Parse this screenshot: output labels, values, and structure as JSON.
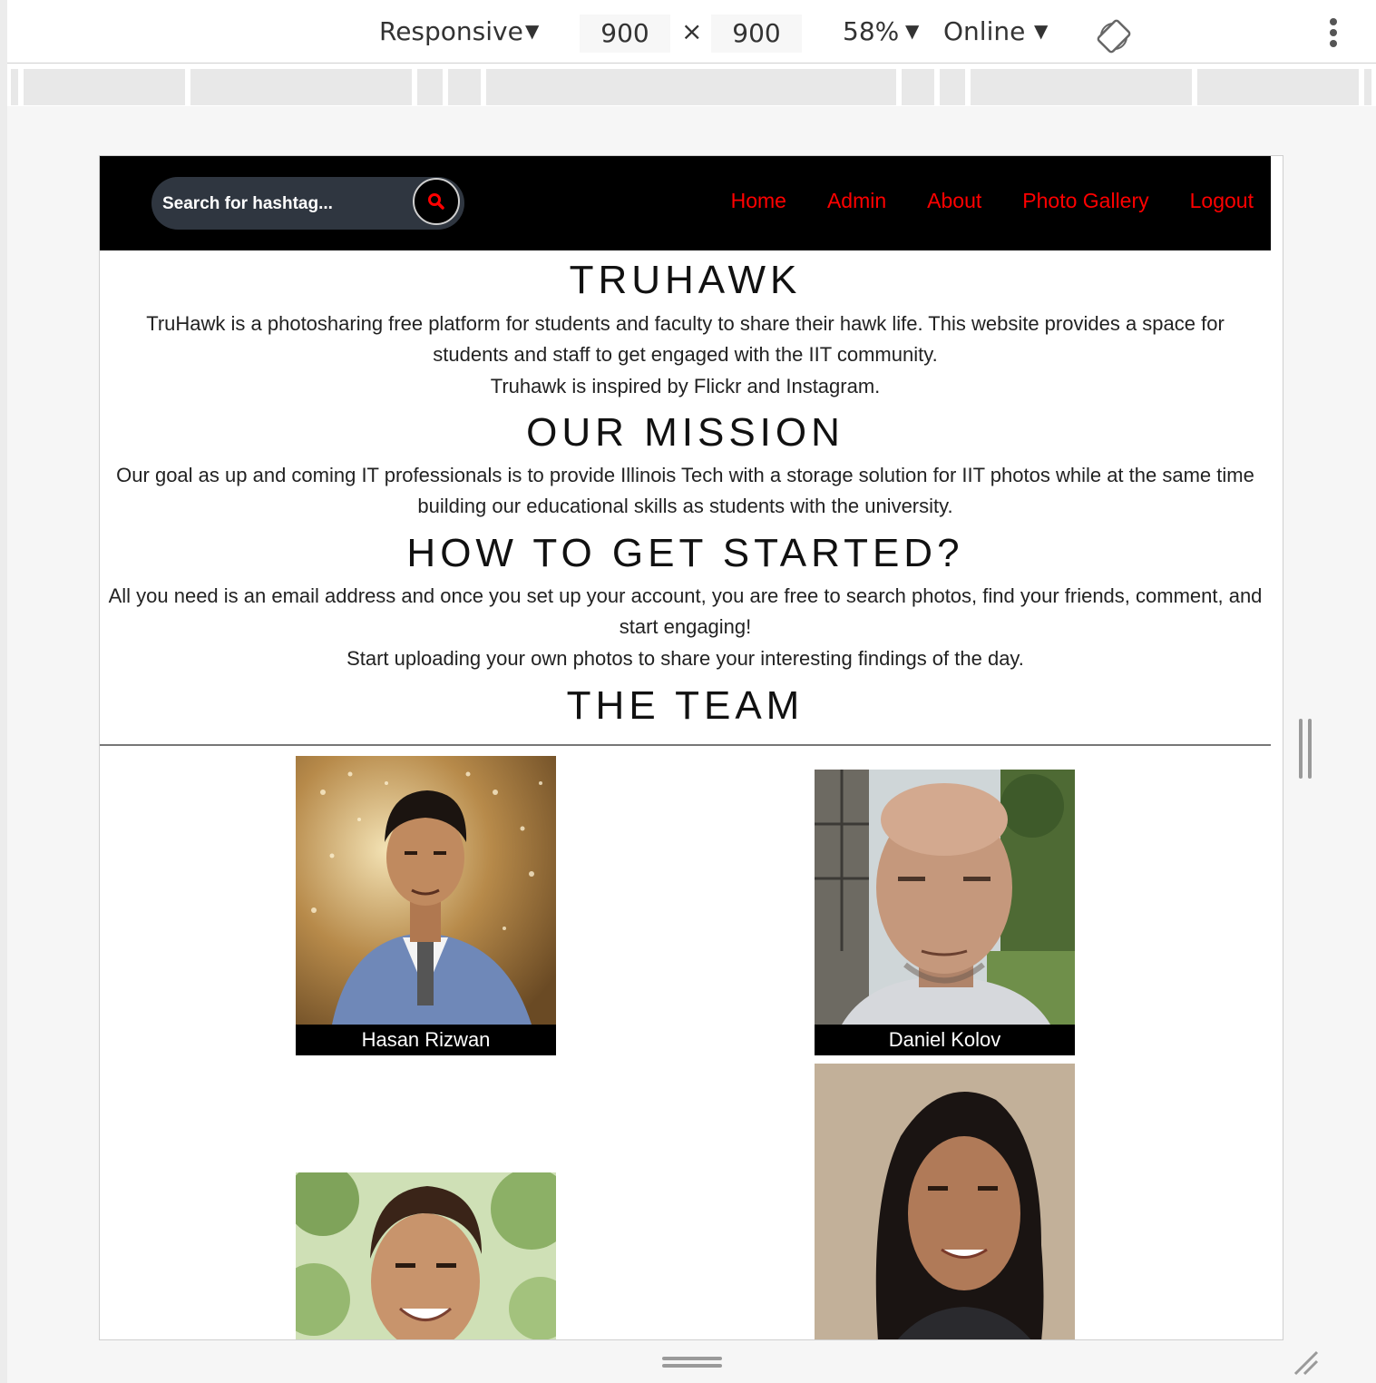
{
  "devtools": {
    "device": "Responsive",
    "width": "900",
    "times": "×",
    "height": "900",
    "zoom": "58%",
    "network": "Online",
    "caret": "▼"
  },
  "site": {
    "search": {
      "placeholder": "Search for hashtag..."
    },
    "nav": {
      "home": "Home",
      "admin": "Admin",
      "about": "About",
      "gallery": "Photo Gallery",
      "logout": "Logout"
    },
    "colors": {
      "nav_link": "#ff0000",
      "navbar_bg": "#000000",
      "search_bg": "#2f3640"
    },
    "sections": {
      "truhawk": {
        "title": "TRUHAWK",
        "line1": "TruHawk is a photosharing free platform for students and faculty to share their hawk life. This website provides a space for students and staff to get engaged with the IIT community.",
        "line2": "Truhawk is inspired by Flickr and Instagram."
      },
      "mission": {
        "title": "OUR MISSION",
        "text": "Our goal as up and coming IT professionals is to provide Illinois Tech with a storage solution for IIT photos while at the same time building our educational skills as students with the university."
      },
      "started": {
        "title": "HOW TO GET STARTED?",
        "line1": "All you need is an email address and once you set up your account, you are free to search photos, find your friends, comment, and start engaging!",
        "line2": "Start uploading your own photos to share your interesting findings of the day."
      },
      "team": {
        "title": "THE TEAM",
        "members": [
          "Hasan Rizwan",
          "Daniel Kolov"
        ]
      }
    }
  }
}
